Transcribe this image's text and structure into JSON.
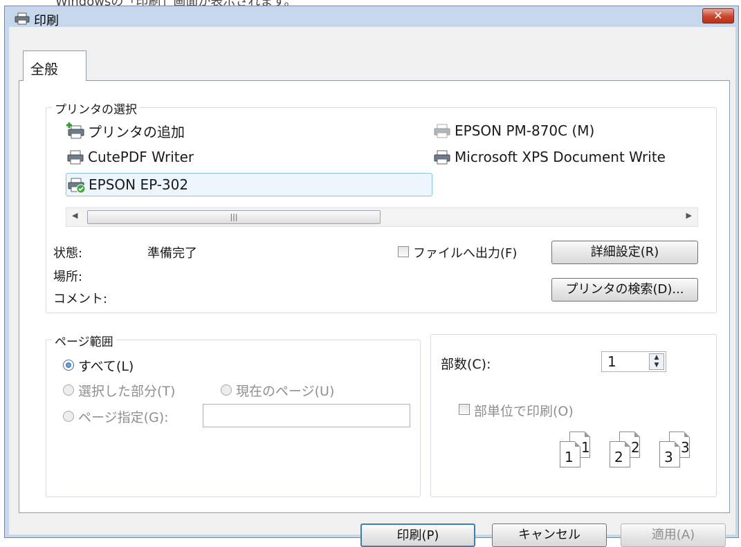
{
  "caption": "Windowsの「印刷」画面が表示されます。",
  "window": {
    "title": "印刷",
    "close_icon": "close-icon"
  },
  "tabs": [
    {
      "label": "全般"
    }
  ],
  "printer_select": {
    "label": "プリンタの選択",
    "printers": [
      {
        "name": "プリンタの追加"
      },
      {
        "name": "EPSON PM-870C (M)"
      },
      {
        "name": "CutePDF Writer"
      },
      {
        "name": "Microsoft XPS Document Write"
      },
      {
        "name": "EPSON EP-302",
        "selected": true
      }
    ],
    "status_label": "状態:",
    "status_value": "準備完了",
    "location_label": "場所:",
    "comment_label": "コメント:",
    "print_to_file_label": "ファイルへ出力(F)",
    "preferences_button": "詳細設定(R)",
    "find_printer_button": "プリンタの検索(D)..."
  },
  "page_range": {
    "label": "ページ範囲",
    "all_label": "すべて(L)",
    "selection_label": "選択した部分(T)",
    "current_page_label": "現在のページ(U)",
    "pages_label": "ページ指定(G):"
  },
  "copies": {
    "label": "部数(C):",
    "value": "1",
    "collate_label": "部単位で印刷(O)",
    "pages": [
      {
        "big": "1",
        "small": "1"
      },
      {
        "big": "2",
        "small": "2"
      },
      {
        "big": "3",
        "small": "3"
      }
    ]
  },
  "buttons": {
    "print": "印刷(P)",
    "cancel": "キャンセル",
    "apply": "適用(A)"
  },
  "colors": {
    "title_bg": "#c7d8ec",
    "close_red": "#c7452c",
    "selection": "#84c2ef"
  }
}
